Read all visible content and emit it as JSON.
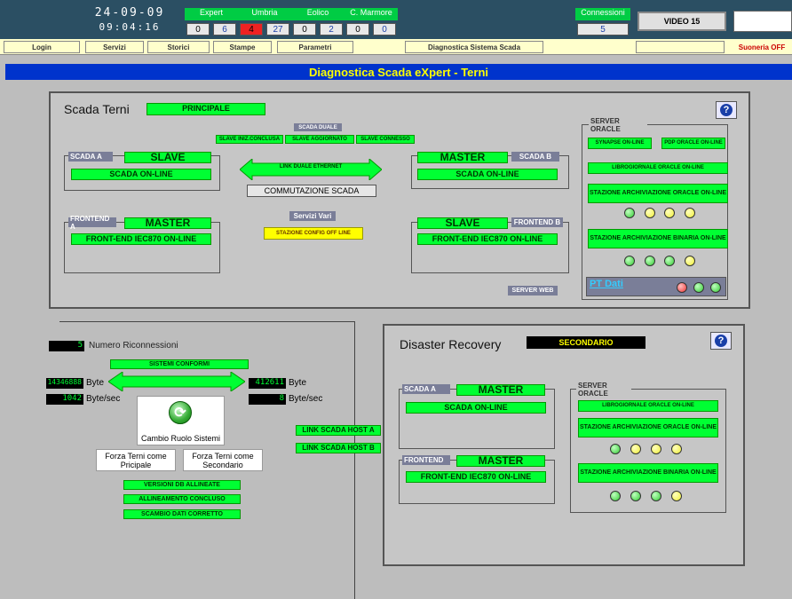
{
  "header": {
    "date": "24-09-09",
    "time": "09:04:16",
    "groups": [
      {
        "name": "Expert",
        "a": "0",
        "b": "6"
      },
      {
        "name": "Umbria",
        "a": "4",
        "b": "27"
      },
      {
        "name": "Eolico",
        "a": "0",
        "b": "2"
      },
      {
        "name": "C. Marmore",
        "a": "0",
        "b": "0"
      }
    ],
    "connessioni_label": "Connessioni",
    "connessioni_value": "5",
    "video_label": "VIDEO 15"
  },
  "menu": {
    "login": "Login",
    "servizi": "Servizi",
    "storici": "Storici",
    "stampe": "Stampe",
    "parametri": "Parametri",
    "diagnostica": "Diagnostica Sistema Scada",
    "suoneria": "Suoneria OFF"
  },
  "title": "Diagnostica Scada eXpert - Terni",
  "terni": {
    "title": "Scada Terni",
    "mode": "PRINCIPALE",
    "scada_duale": "SCADA DUALE",
    "duale_status": [
      "SLAVE INIZ.CONCLUSA",
      "SLAVE AGGIORNATO",
      "SLAVE CONNESSO"
    ],
    "scada_a": {
      "label": "SCADA A",
      "role": "SLAVE",
      "status": "SCADA ON-LINE"
    },
    "scada_b": {
      "label": "SCADA B",
      "role": "MASTER",
      "status": "SCADA ON-LINE"
    },
    "frontend_a": {
      "label": "FRONTEND A",
      "role": "MASTER",
      "status": "FRONT-END IEC870 ON-LINE"
    },
    "frontend_b": {
      "label": "FRONTEND B",
      "role": "SLAVE",
      "status": "FRONT-END IEC870 ON-LINE"
    },
    "link_duale": "LINK DUALE ETHERNET",
    "commutazione": "COMMUTAZIONE SCADA",
    "servizi_vari": "Servizi Vari",
    "stazione_config": "STAZIONE CONFIG OFF LINE",
    "server_web": "SERVER WEB",
    "server_oracle": {
      "label": "SERVER ORACLE",
      "synapse": "SYNAPSE ON-LINE",
      "pdp": "PDP ORACLE ON-LINE",
      "libro": "LIBROGIORNALE ORACLE ON-LINE",
      "arch_oracle": "STAZIONE ARCHIVIAZIONE ORACLE ON-LINE",
      "arch_binaria": "STAZIONE ARCHIVIAZIONE BINARIA ON-LINE",
      "pt_dati": "PT Dati"
    }
  },
  "link": {
    "numero_value": "5",
    "numero_label": "Numero Riconnessioni",
    "sistemi": "SISTEMI CONFORMI",
    "left_bytes": "14346888",
    "left_rate": "1042",
    "right_bytes": "412611",
    "right_rate": "8",
    "byte": "Byte",
    "byte_sec": "Byte/sec",
    "cambio": "Cambio Ruolo Sistemi",
    "forza_principale": "Forza Terni come Pricipale",
    "forza_secondario": "Forza Terni come Secondario",
    "versioni": "VERSIONI DB ALLINEATE",
    "allineamento": "ALLINEAMENTO CONCLUSO",
    "scambio": "SCAMBIO DATI CORRETTO",
    "host_a": "LINK SCADA HOST A",
    "host_b": "LINK SCADA HOST B"
  },
  "dr": {
    "title": "Disaster Recovery",
    "mode": "SECONDARIO",
    "scada_a": {
      "label": "SCADA A",
      "role": "MASTER",
      "status": "SCADA ON-LINE"
    },
    "frontend": {
      "label": "FRONTEND",
      "role": "MASTER",
      "status": "FRONT-END IEC870 ON-LINE"
    },
    "server_oracle": {
      "label": "SERVER ORACLE",
      "libro": "LIBROGIORNALE ORACLE ON-LINE",
      "arch_oracle": "STAZIONE ARCHIVIAZIONE ORACLE ON-LINE",
      "arch_binaria": "STAZIONE ARCHIVIAZIONE BINARIA ON-LINE"
    }
  },
  "colors": {
    "green": "#00ff33",
    "yellow": "#ffff00",
    "red": "#ee3333",
    "blue_bar": "#0033cc",
    "header_bg": "#2b4f63"
  }
}
